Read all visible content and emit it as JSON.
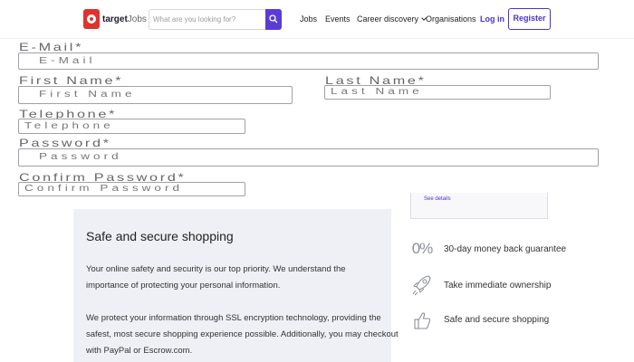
{
  "header": {
    "logo_brand": "target",
    "logo_suffix": "Jobs",
    "search_placeholder": "What are you looking for?",
    "nav": {
      "jobs": "Jobs",
      "events": "Events",
      "career_discovery": "Career discovery",
      "organisations": "Organisations"
    },
    "login": "Log in",
    "register": "Register",
    "accent_color": "#4b33c9"
  },
  "form": {
    "email_label": "E-Mail*",
    "email_placeholder": "E-Mail",
    "first_name_label": "First Name*",
    "first_name_placeholder": "First Name",
    "last_name_label": "Last Name*",
    "last_name_placeholder": "Last Name",
    "telephone_label": "Telephone*",
    "telephone_placeholder": "Telephone",
    "password_label": "Password*",
    "password_placeholder": "Password",
    "confirm_password_label": "Confirm Password*",
    "confirm_password_placeholder": "Confirm Password"
  },
  "side_card": {
    "link": "See details"
  },
  "secure": {
    "title": "Safe and secure shopping",
    "paragraph1": "Your online safety and security is our top priority. We understand the importance of protecting your personal information.",
    "paragraph2": "We protect your information through SSL encryption technology, providing the safest, most secure shopping experience possible. Additionally, you may checkout with PayPal or Escrow.com."
  },
  "benefits": {
    "money_back_icon_text": "0%",
    "money_back": "30-day money back guarantee",
    "ownership": "Take immediate ownership",
    "secure": "Safe and secure shopping"
  }
}
